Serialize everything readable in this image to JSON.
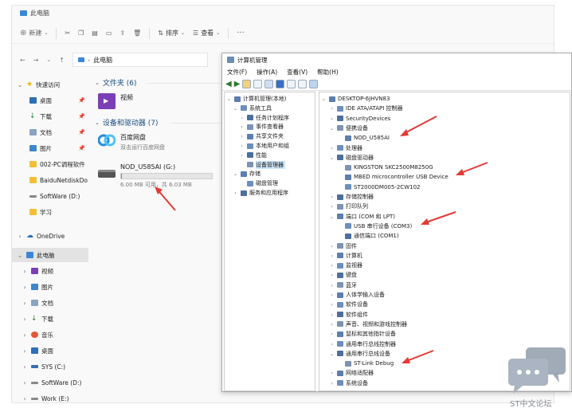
{
  "explorer": {
    "title": "此电脑",
    "toolbar": {
      "new": "新建",
      "sort": "排序",
      "view": "查看",
      "more": "···"
    },
    "address": "此电脑",
    "nav": {
      "quick_access": "快速访问",
      "pinned": [
        "桌面",
        "下载",
        "文档",
        "图片"
      ],
      "folders": [
        "002-PC调程软件",
        "BaiduNetdiskDo",
        "SoftWare (D:)",
        "学习"
      ],
      "onedrive": "OneDrive",
      "this_pc": "此电脑",
      "pc_items": [
        "视频",
        "图片",
        "文档",
        "下载",
        "音乐",
        "桌面",
        "SYS (C:)",
        "SoftWare (D:)",
        "Work (E:)"
      ]
    },
    "folders_section": {
      "header": "文件夹 (6)",
      "items": [
        {
          "name": "视频"
        }
      ]
    },
    "devices_section": {
      "header": "设备和驱动器 (7)",
      "baidu": {
        "name": "百度网盘",
        "sub": "双击运行百度网盘"
      },
      "drive": {
        "name": "NOD_U585AI (G:)",
        "usage": "6.00 MB 可用，共 6.03 MB",
        "fill_fraction": 0.005
      }
    }
  },
  "devmgr": {
    "title": "计算机管理",
    "menu": [
      "文件(F)",
      "操作(A)",
      "查看(V)",
      "帮助(H)"
    ],
    "left_tree": [
      {
        "label": "计算机管理(本地)",
        "level": 0,
        "chev": "⌄"
      },
      {
        "label": "系统工具",
        "level": 1,
        "chev": "⌄"
      },
      {
        "label": "任务计划程序",
        "level": 2,
        "chev": "›"
      },
      {
        "label": "事件查看器",
        "level": 2,
        "chev": "›"
      },
      {
        "label": "共享文件夹",
        "level": 2,
        "chev": "›"
      },
      {
        "label": "本地用户和组",
        "level": 2,
        "chev": "›"
      },
      {
        "label": "性能",
        "level": 2,
        "chev": "›"
      },
      {
        "label": "设备管理器",
        "level": 2,
        "chev": "",
        "selected": true
      },
      {
        "label": "存储",
        "level": 1,
        "chev": "⌄"
      },
      {
        "label": "磁盘管理",
        "level": 2,
        "chev": ""
      },
      {
        "label": "服务和应用程序",
        "level": 1,
        "chev": "›"
      }
    ],
    "right_tree": [
      {
        "label": "DESKTOP-6JHVN83",
        "level": 0,
        "chev": "⌄"
      },
      {
        "label": "IDE ATA/ATAPI 控制器",
        "level": 1,
        "chev": "›"
      },
      {
        "label": "SecurityDevices",
        "level": 1,
        "chev": "›"
      },
      {
        "label": "便携设备",
        "level": 1,
        "chev": "⌄"
      },
      {
        "label": "NOD_U585AI",
        "level": 2,
        "chev": ""
      },
      {
        "label": "处理器",
        "level": 1,
        "chev": "›"
      },
      {
        "label": "磁盘驱动器",
        "level": 1,
        "chev": "⌄"
      },
      {
        "label": "KINGSTON SKC2500M8250G",
        "level": 2,
        "chev": ""
      },
      {
        "label": "MBED microcontroller USB Device",
        "level": 2,
        "chev": ""
      },
      {
        "label": "ST2000DM005-2CW102",
        "level": 2,
        "chev": ""
      },
      {
        "label": "存储控制器",
        "level": 1,
        "chev": "›"
      },
      {
        "label": "打印队列",
        "level": 1,
        "chev": "›"
      },
      {
        "label": "端口 (COM 和 LPT)",
        "level": 1,
        "chev": "⌄"
      },
      {
        "label": "USB 串行设备 (COM3)",
        "level": 2,
        "chev": ""
      },
      {
        "label": "通信端口 (COM1)",
        "level": 2,
        "chev": ""
      },
      {
        "label": "固件",
        "level": 1,
        "chev": "›"
      },
      {
        "label": "计算机",
        "level": 1,
        "chev": "›"
      },
      {
        "label": "监视器",
        "level": 1,
        "chev": "›"
      },
      {
        "label": "键盘",
        "level": 1,
        "chev": "›"
      },
      {
        "label": "蓝牙",
        "level": 1,
        "chev": "›"
      },
      {
        "label": "人体学输入设备",
        "level": 1,
        "chev": "›"
      },
      {
        "label": "软件设备",
        "level": 1,
        "chev": "›"
      },
      {
        "label": "软件组件",
        "level": 1,
        "chev": "›"
      },
      {
        "label": "声音、视频和游戏控制器",
        "level": 1,
        "chev": "›"
      },
      {
        "label": "鼠标和其他指针设备",
        "level": 1,
        "chev": "›"
      },
      {
        "label": "通用串行总线控制器",
        "level": 1,
        "chev": "›"
      },
      {
        "label": "通用串行总线设备",
        "level": 1,
        "chev": "⌄"
      },
      {
        "label": "ST-Link Debug",
        "level": 2,
        "chev": ""
      },
      {
        "label": "网络适配器",
        "level": 1,
        "chev": "›"
      },
      {
        "label": "系统设备",
        "level": 1,
        "chev": "›"
      }
    ]
  },
  "watermark": {
    "text": "ST中文论坛"
  },
  "colors": {
    "arrow": "#e53935",
    "folder": "#f2c037",
    "select": "#cce4f7",
    "accent": "#1b4d7e"
  }
}
